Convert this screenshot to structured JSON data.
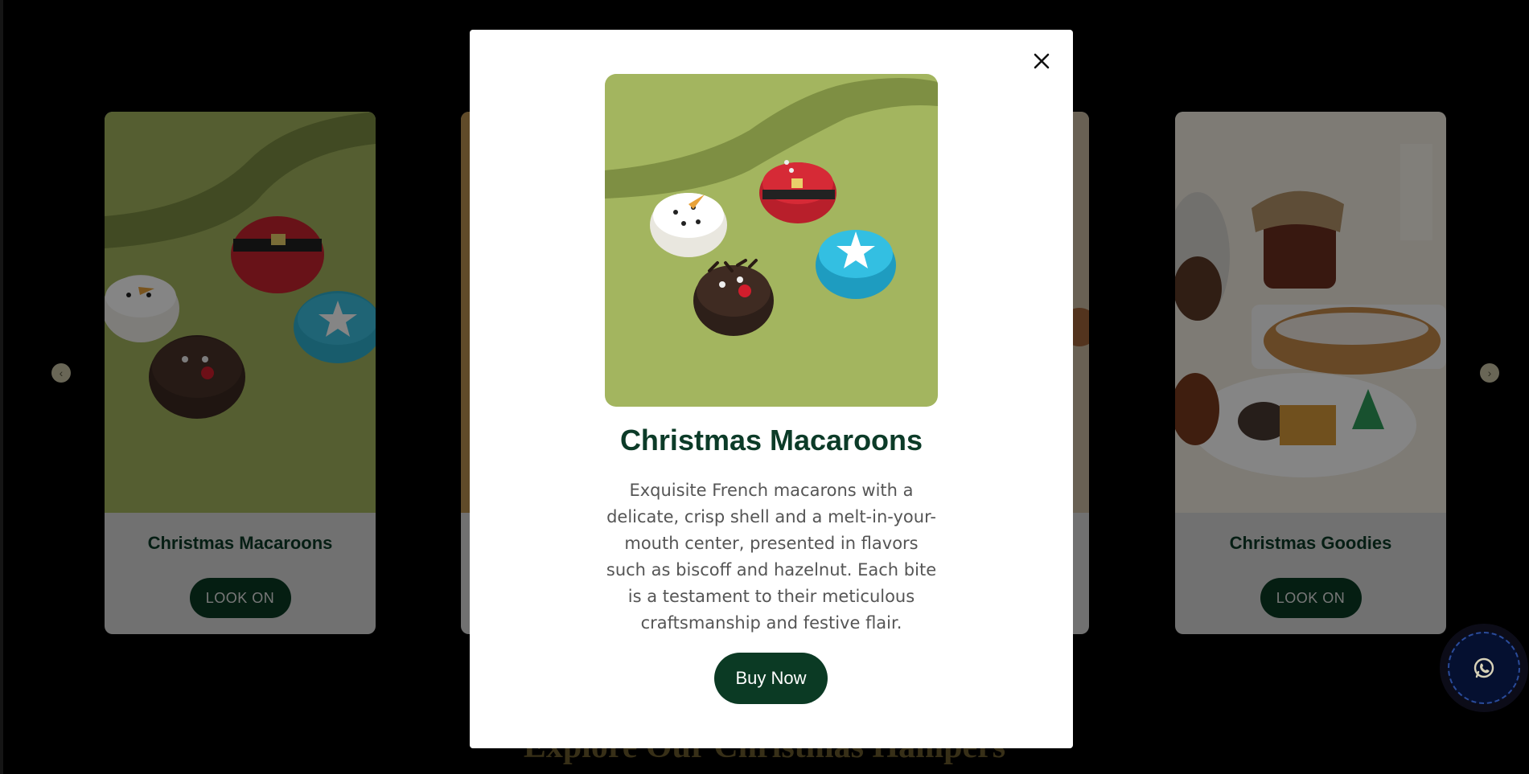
{
  "cards": [
    {
      "title": "Christmas Macaroons",
      "button": "LOOK ON"
    },
    {
      "title": "Christmas Goodies",
      "button": "LOOK ON"
    }
  ],
  "section": {
    "title": "Explore Our Christmas Hampers"
  },
  "modal": {
    "title": "Christmas Macaroons",
    "description": "Exquisite French macarons with a delicate, crisp shell and a melt-in-your-mouth center, presented in flavors such as biscoff and hazelnut. Each bite is a testament to their meticulous craftsmanship and festive flair.",
    "buy_label": "Buy Now",
    "close_icon": "close-icon"
  },
  "icons": {
    "prev": "chevron-left-icon",
    "next": "chevron-right-icon",
    "whatsapp": "whatsapp-icon"
  },
  "colors": {
    "brand_green": "#0b3a24",
    "title_green": "#0c3b28",
    "card_bg": "#d9d9d9",
    "macaron_bg": "#a3b55f"
  }
}
